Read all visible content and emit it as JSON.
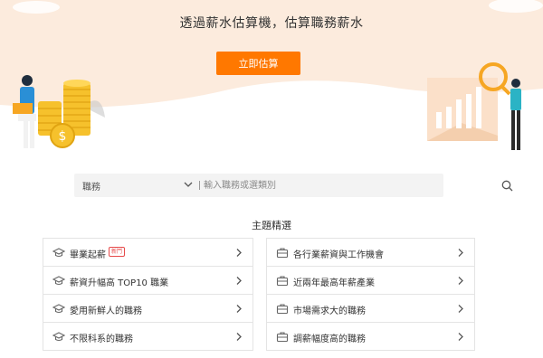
{
  "hero": {
    "title": "透過薪水估算機，估算職務薪水",
    "cta_label": "立即估算",
    "colors": {
      "background": "#fcebdd",
      "cta": "#ff7800"
    }
  },
  "search": {
    "category_label": "職務",
    "placeholder": "輸入職務或選類別"
  },
  "topics": {
    "title": "主題精選",
    "left": [
      {
        "label": "畢業起薪",
        "badge": "新鬥",
        "icon": "graduation-cap-icon"
      },
      {
        "label": "薪資升幅高 TOP10 職業",
        "icon": "graduation-cap-icon"
      },
      {
        "label": "愛用新鮮人的職務",
        "icon": "graduation-cap-icon"
      },
      {
        "label": "不限科系的職務",
        "icon": "graduation-cap-icon"
      }
    ],
    "right": [
      {
        "label": "各行業薪資與工作機會",
        "icon": "briefcase-icon"
      },
      {
        "label": "近兩年最高年薪產業",
        "icon": "briefcase-icon"
      },
      {
        "label": "市場需求大的職務",
        "icon": "briefcase-icon"
      },
      {
        "label": "調薪幅度高的職務",
        "icon": "briefcase-icon"
      }
    ]
  }
}
